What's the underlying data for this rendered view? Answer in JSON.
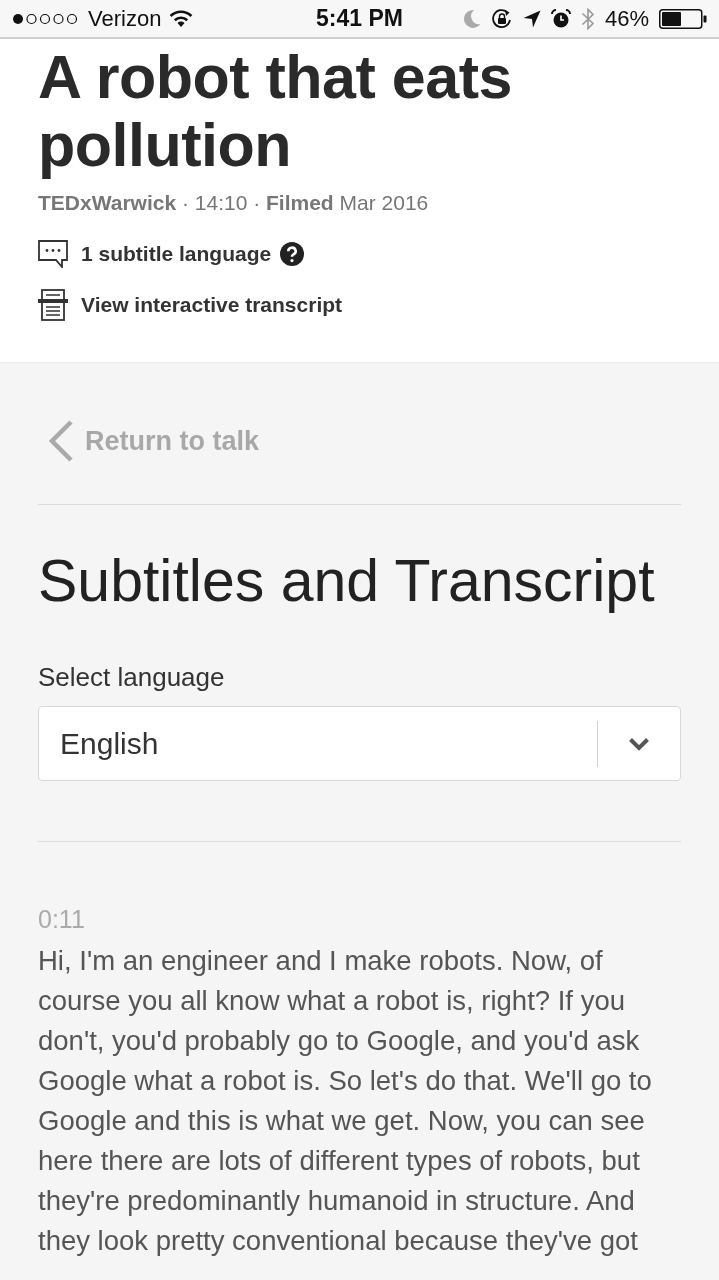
{
  "status_bar": {
    "carrier": "Verizon",
    "time": "5:41 PM",
    "battery": "46%"
  },
  "talk": {
    "title": "A robot that eats pollution",
    "meta": "**TEDxWarwick** · 14:10 · **Filmed** Mar 2016",
    "subtitles": "1 subtitle language",
    "transcript_link": "View interactive transcript"
  },
  "transcript_page": {
    "back_link": "Return to talk",
    "heading": "Subtitles and Transcript",
    "language_label": "Select language",
    "language_select": {
      "value": "English"
    },
    "paragraphs": [
      {
        "time": "0:11",
        "text": "Hi, I'm an engineer and I make robots. Now, of course you all know what a robot is, right? If you don't, you'd probably go to Google, and you'd ask Google what a robot is. So let's do that. We'll go to Google and this is what we get. Now, you can see here there are lots of different types of robots, but they're predominantly humanoid in structure. And they look pretty conventional because they've got"
      }
    ]
  }
}
